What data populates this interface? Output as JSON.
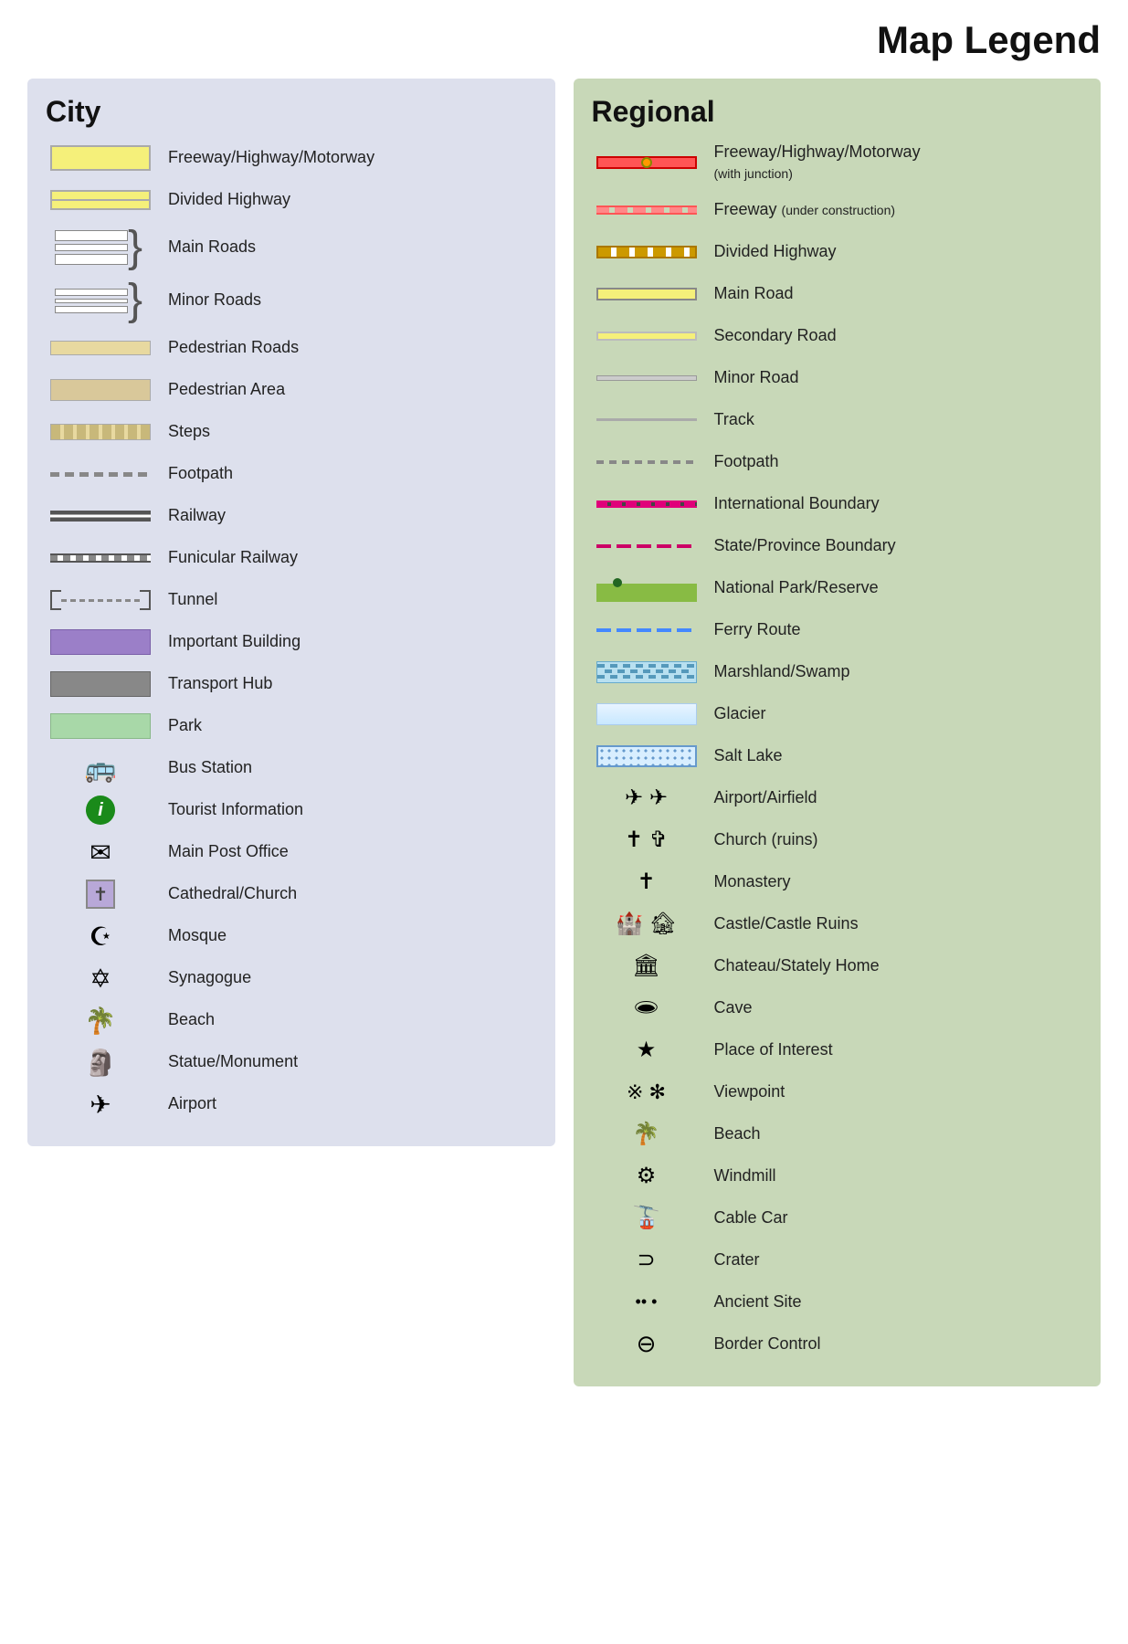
{
  "title": "Map Legend",
  "city": {
    "heading": "City",
    "items": [
      {
        "label": "Freeway/Highway/Motorway",
        "symbol": "freeway-city"
      },
      {
        "label": "Divided Highway",
        "symbol": "divided-hwy-city"
      },
      {
        "label": "Main Roads",
        "symbol": "main-roads"
      },
      {
        "label": "Minor Roads",
        "symbol": "minor-roads"
      },
      {
        "label": "Pedestrian Roads",
        "symbol": "ped-roads"
      },
      {
        "label": "Pedestrian Area",
        "symbol": "ped-area"
      },
      {
        "label": "Steps",
        "symbol": "steps"
      },
      {
        "label": "Footpath",
        "symbol": "footpath"
      },
      {
        "label": "Railway",
        "symbol": "railway"
      },
      {
        "label": "Funicular Railway",
        "symbol": "funicular"
      },
      {
        "label": "Tunnel",
        "symbol": "tunnel"
      },
      {
        "label": "Important Building",
        "symbol": "important-bldg"
      },
      {
        "label": "Transport Hub",
        "symbol": "transport-hub"
      },
      {
        "label": "Park",
        "symbol": "park"
      },
      {
        "label": "Bus Station",
        "symbol": "bus-icon"
      },
      {
        "label": "Tourist Information",
        "symbol": "info-icon"
      },
      {
        "label": "Main Post Office",
        "symbol": "post-icon"
      },
      {
        "label": "Cathedral/Church",
        "symbol": "church-icon"
      },
      {
        "label": "Mosque",
        "symbol": "mosque-icon"
      },
      {
        "label": "Synagogue",
        "symbol": "synagogue-icon"
      },
      {
        "label": "Beach",
        "symbol": "beach-icon"
      },
      {
        "label": "Statue/Monument",
        "symbol": "statue-icon"
      },
      {
        "label": "Airport",
        "symbol": "airport-icon"
      }
    ]
  },
  "regional": {
    "heading": "Regional",
    "items": [
      {
        "label": "Freeway/Highway/Motorway",
        "sublabel": "(with junction)",
        "symbol": "freeway-reg"
      },
      {
        "label": "Freeway",
        "sublabel": "(under construction)",
        "symbol": "freeway-reg2"
      },
      {
        "label": "Divided Highway",
        "symbol": "div-hwy-reg"
      },
      {
        "label": "Main Road",
        "symbol": "main-road-reg"
      },
      {
        "label": "Secondary Road",
        "symbol": "secondary-road-reg"
      },
      {
        "label": "Minor Road",
        "symbol": "minor-road-reg"
      },
      {
        "label": "Track",
        "symbol": "track-reg"
      },
      {
        "label": "Footpath",
        "symbol": "footpath-reg"
      },
      {
        "label": "International Boundary",
        "symbol": "intl-boundary"
      },
      {
        "label": "State/Province Boundary",
        "symbol": "state-boundary"
      },
      {
        "label": "National Park/Reserve",
        "symbol": "natl-park"
      },
      {
        "label": "Ferry Route",
        "symbol": "ferry-route"
      },
      {
        "label": "Marshland/Swamp",
        "symbol": "marshland"
      },
      {
        "label": "Glacier",
        "symbol": "glacier"
      },
      {
        "label": "Salt Lake",
        "symbol": "salt-lake"
      },
      {
        "label": "Airport/Airfield",
        "symbol": "airport-reg"
      },
      {
        "label": "Church (ruins)",
        "symbol": "church-reg"
      },
      {
        "label": "Monastery",
        "symbol": "monastery-reg"
      },
      {
        "label": "Castle/Castle Ruins",
        "symbol": "castle-reg"
      },
      {
        "label": "Chateau/Stately Home",
        "symbol": "chateau-reg"
      },
      {
        "label": "Cave",
        "symbol": "cave-reg"
      },
      {
        "label": "Place of Interest",
        "symbol": "poi-reg"
      },
      {
        "label": "Viewpoint",
        "symbol": "viewpoint-reg"
      },
      {
        "label": "Beach",
        "symbol": "beach-reg"
      },
      {
        "label": "Windmill",
        "symbol": "windmill-reg"
      },
      {
        "label": "Cable Car",
        "symbol": "cablecar-reg"
      },
      {
        "label": "Crater",
        "symbol": "crater-reg"
      },
      {
        "label": "Ancient Site",
        "symbol": "ancient-reg"
      },
      {
        "label": "Border Control",
        "symbol": "border-reg"
      }
    ]
  }
}
